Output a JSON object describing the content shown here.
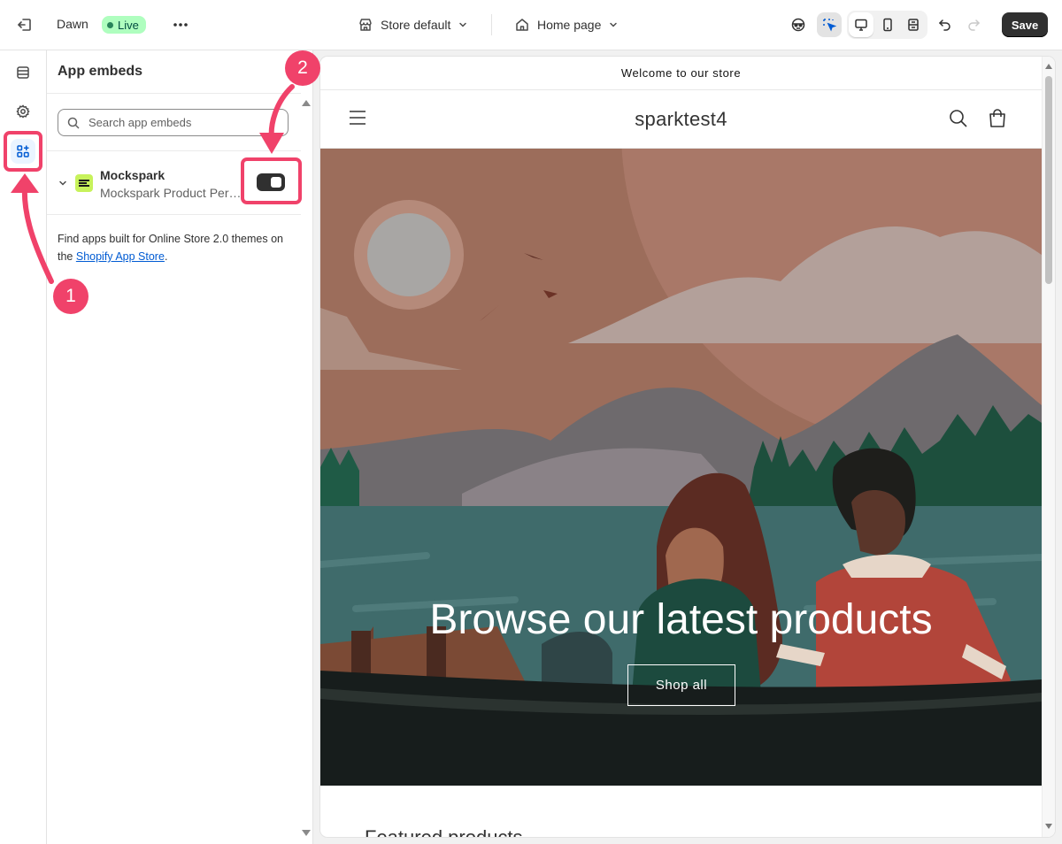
{
  "topbar": {
    "theme_name": "Dawn",
    "status_badge": "Live",
    "store_selector": "Store default",
    "page_selector": "Home page",
    "save_label": "Save"
  },
  "sidebar": {
    "items": [
      {
        "name": "sections",
        "icon": "sections-icon",
        "active": false
      },
      {
        "name": "theme-settings",
        "icon": "gear-icon",
        "active": false
      },
      {
        "name": "app-embeds",
        "icon": "app-embeds-icon",
        "active": true
      }
    ]
  },
  "panel": {
    "title": "App embeds",
    "search_placeholder": "Search app embeds",
    "embeds": [
      {
        "name": "Mockspark",
        "description": "Mockspark Product Per…",
        "enabled": true
      }
    ],
    "help_text_prefix": "Find apps built for Online Store 2.0 themes on the ",
    "help_link": "Shopify App Store",
    "help_text_suffix": "."
  },
  "preview": {
    "announcement": "Welcome to our store",
    "store_name": "sparktest4",
    "hero_heading": "Browse our latest products",
    "hero_button": "Shop all",
    "featured_title": "Featured products"
  },
  "annotations": {
    "marker_1": "1",
    "marker_2": "2",
    "color": "#f0426a"
  },
  "colors": {
    "accent": "#005bd3",
    "live_badge": "#affebf",
    "primary_button": "#303030"
  }
}
